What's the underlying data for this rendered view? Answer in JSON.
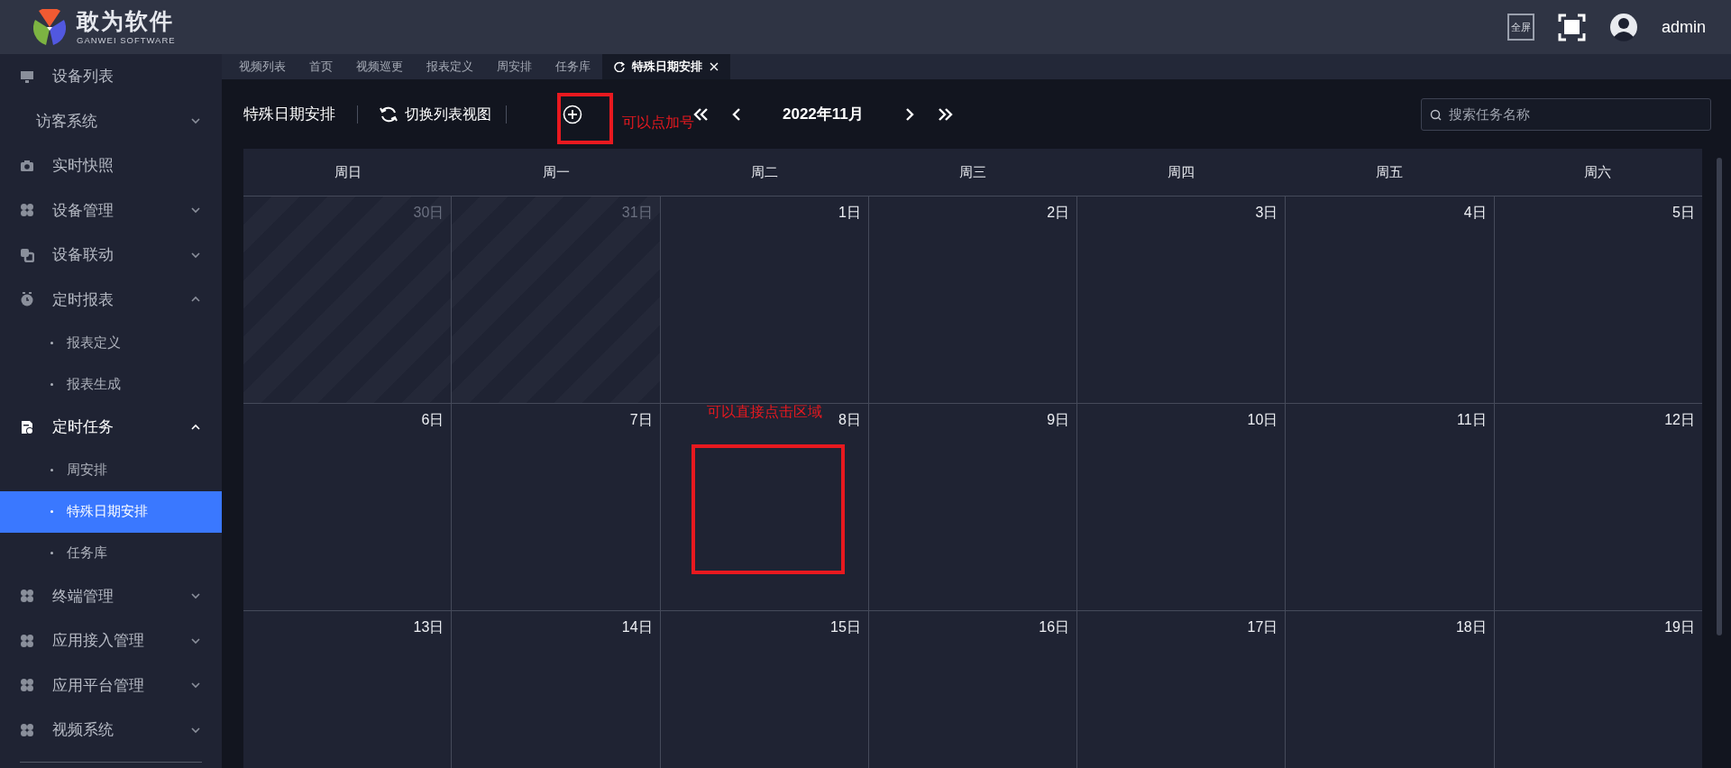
{
  "header": {
    "logo_title": "敢为软件",
    "logo_subtitle": "GANWEI SOFTWARE",
    "fullscreen_label": "全屏",
    "user": "admin"
  },
  "sidebar": {
    "items": [
      {
        "label": "设备列表",
        "kind": "link",
        "selected": false
      },
      {
        "label": "访客系统",
        "kind": "group",
        "expanded": false,
        "selected": false
      },
      {
        "label": "实时快照",
        "kind": "link",
        "selected": false
      },
      {
        "label": "设备管理",
        "kind": "group",
        "expanded": false,
        "selected": false
      },
      {
        "label": "设备联动",
        "kind": "group",
        "expanded": false,
        "selected": false
      },
      {
        "label": "定时报表",
        "kind": "group",
        "expanded": true,
        "selected": false,
        "children": [
          {
            "label": "报表定义",
            "selected": false
          },
          {
            "label": "报表生成",
            "selected": false
          }
        ]
      },
      {
        "label": "定时任务",
        "kind": "group",
        "expanded": true,
        "selected": true,
        "children": [
          {
            "label": "周安排",
            "selected": false
          },
          {
            "label": "特殊日期安排",
            "selected": true
          },
          {
            "label": "任务库",
            "selected": false
          }
        ]
      },
      {
        "label": "终端管理",
        "kind": "group",
        "expanded": false,
        "selected": false
      },
      {
        "label": "应用接入管理",
        "kind": "group",
        "expanded": false,
        "selected": false
      },
      {
        "label": "应用平台管理",
        "kind": "group",
        "expanded": false,
        "selected": false
      },
      {
        "label": "视频系统",
        "kind": "group",
        "expanded": false,
        "selected": false
      }
    ]
  },
  "tabs": [
    {
      "label": "视频列表",
      "selected": false
    },
    {
      "label": "首页",
      "selected": false
    },
    {
      "label": "视频巡更",
      "selected": false
    },
    {
      "label": "报表定义",
      "selected": false
    },
    {
      "label": "周安排",
      "selected": false
    },
    {
      "label": "任务库",
      "selected": false
    },
    {
      "label": "特殊日期安排",
      "selected": true
    }
  ],
  "toolbar": {
    "title": "特殊日期安排",
    "switch_view": "切换列表视图",
    "month": "2022年11月",
    "search": {
      "placeholder": "搜索任务名称"
    }
  },
  "calendar": {
    "weekdays": [
      "周日",
      "周一",
      "周二",
      "周三",
      "周四",
      "周五",
      "周六"
    ],
    "weeks": [
      [
        {
          "label": "30日",
          "other_month": true
        },
        {
          "label": "31日",
          "other_month": true
        },
        {
          "label": "1日",
          "other_month": false
        },
        {
          "label": "2日",
          "other_month": false
        },
        {
          "label": "3日",
          "other_month": false
        },
        {
          "label": "4日",
          "other_month": false
        },
        {
          "label": "5日",
          "other_month": false
        }
      ],
      [
        {
          "label": "6日",
          "other_month": false
        },
        {
          "label": "7日",
          "other_month": false
        },
        {
          "label": "8日",
          "other_month": false
        },
        {
          "label": "9日",
          "other_month": false
        },
        {
          "label": "10日",
          "other_month": false
        },
        {
          "label": "11日",
          "other_month": false
        },
        {
          "label": "12日",
          "other_month": false
        }
      ],
      [
        {
          "label": "13日",
          "other_month": false
        },
        {
          "label": "14日",
          "other_month": false
        },
        {
          "label": "15日",
          "other_month": false
        },
        {
          "label": "16日",
          "other_month": false
        },
        {
          "label": "17日",
          "other_month": false
        },
        {
          "label": "18日",
          "other_month": false
        },
        {
          "label": "19日",
          "other_month": false
        }
      ]
    ]
  },
  "annotations": [
    {
      "text": "可以点加号"
    },
    {
      "text": "可以直接点击区域"
    }
  ]
}
